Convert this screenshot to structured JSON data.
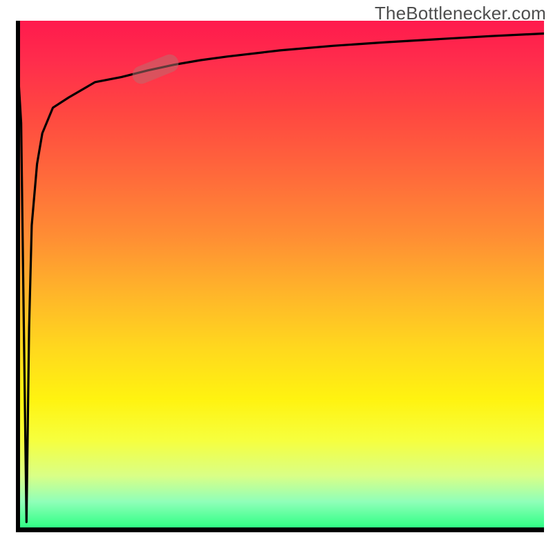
{
  "watermark": "TheBottlenecker.com",
  "colors": {
    "top": "#ff1a4d",
    "mid": "#ffd81e",
    "bottom": "#1eff7b",
    "curve": "#000000",
    "marker": "rgba(185,112,112,0.52)",
    "watermark_text": "#4e4e4e"
  },
  "chart_data": {
    "type": "line",
    "title": "",
    "xlabel": "",
    "ylabel": "",
    "x_range": [
      0,
      100
    ],
    "y_range": [
      0,
      100
    ],
    "background_gradient_description": "vertical heat map: red at top through orange, yellow, to green at bottom",
    "series": [
      {
        "name": "bottleneck-spike",
        "comment": "Sharp down-spike near x≈2 reaching y≈0 then returning to near-top baseline",
        "x": [
          0,
          1,
          1.5,
          2,
          2.5,
          3,
          4,
          5,
          7,
          10
        ],
        "y": [
          97,
          80,
          40,
          2,
          40,
          60,
          72,
          78,
          83,
          85
        ]
      },
      {
        "name": "main-curve",
        "comment": "Monotonic rise that flattens toward ~y≈97 at the right edge",
        "x": [
          5,
          7,
          10,
          15,
          20,
          25,
          30,
          35,
          40,
          50,
          60,
          70,
          80,
          90,
          100
        ],
        "y": [
          78,
          83,
          85,
          88,
          89,
          90.3,
          91.4,
          92.3,
          93,
          94.2,
          95.1,
          95.8,
          96.4,
          97,
          97.5
        ]
      }
    ],
    "highlight_marker": {
      "comment": "pink rounded segment overlaid on the main curve",
      "x_center": 26.5,
      "y_center": 90.5,
      "angle_deg": -22
    }
  }
}
